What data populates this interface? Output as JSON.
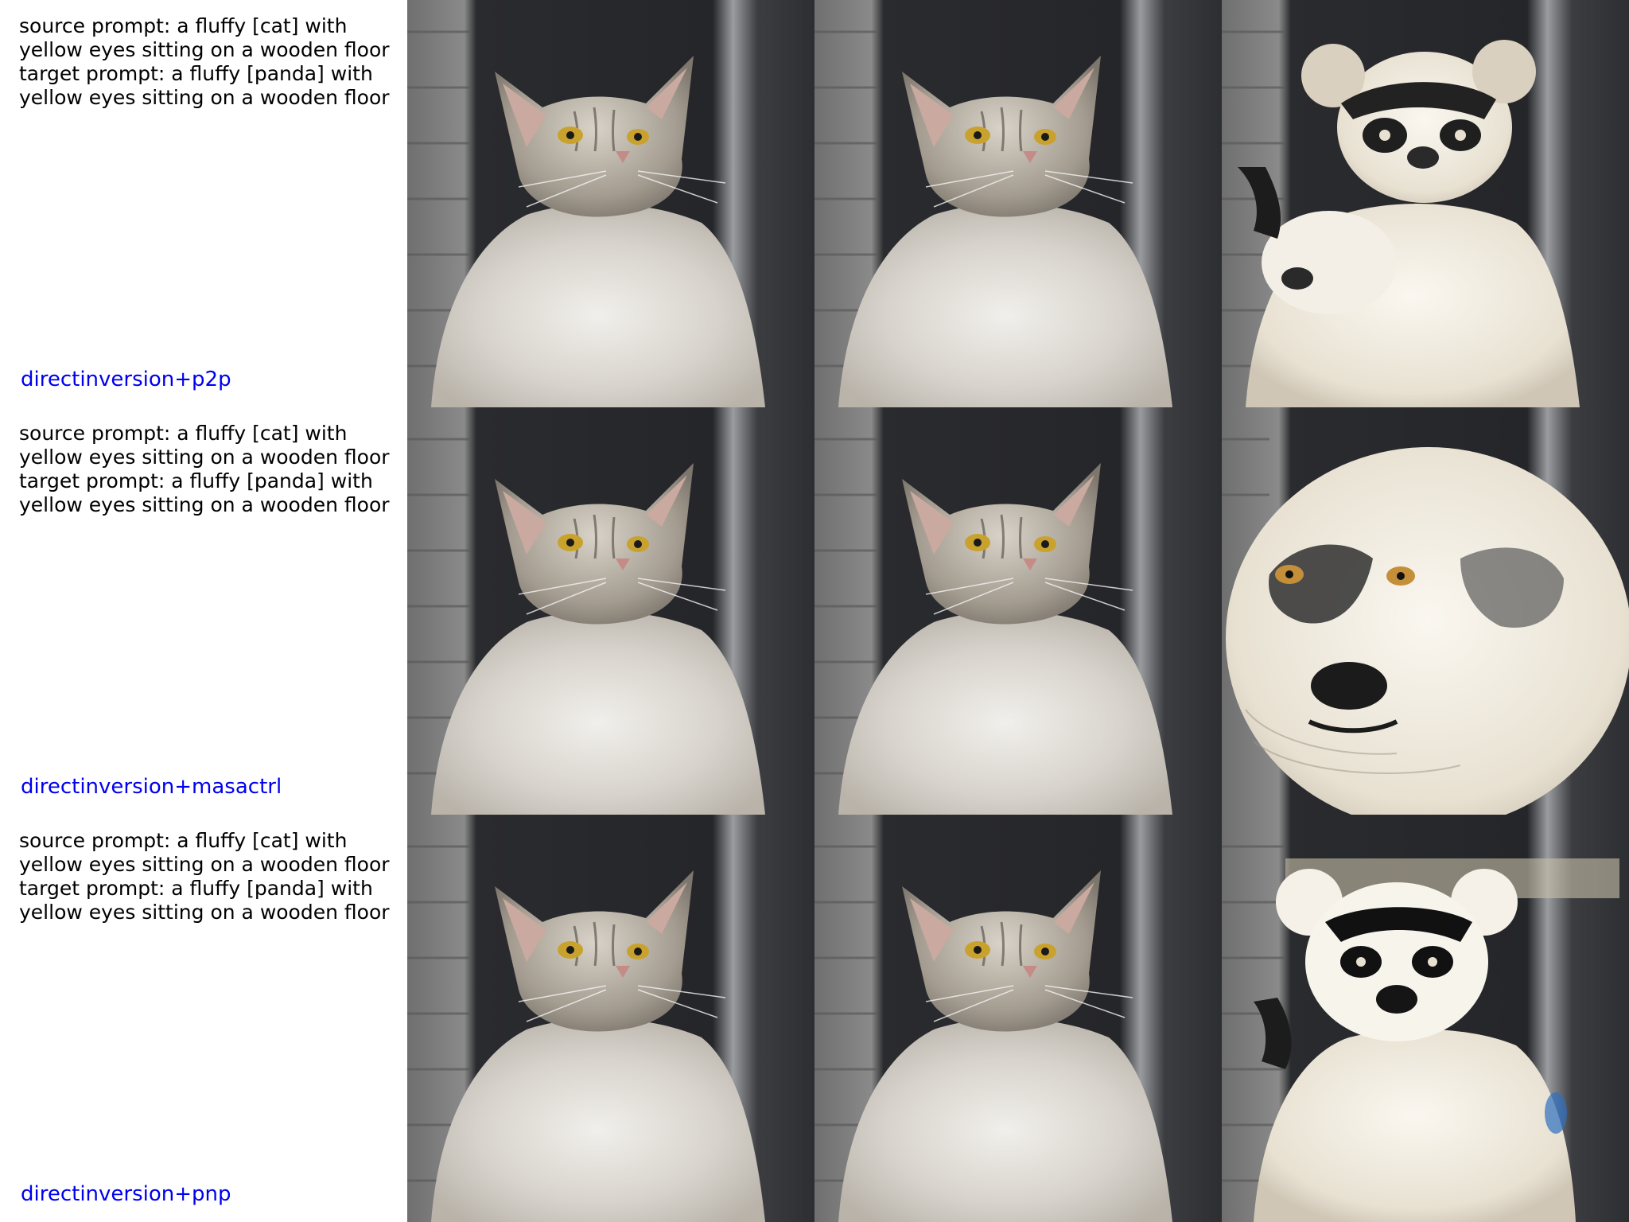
{
  "rows": [
    {
      "source_prompt": [
        "source prompt: a fluffy [cat] with",
        "yellow eyes sitting on a wooden floor"
      ],
      "target_prompt": [
        "target prompt: a fluffy [panda] with",
        "yellow eyes sitting on a wooden floor"
      ],
      "method": "directinversion+p2p",
      "method_color": "#0000ee",
      "images": [
        "cat-photo",
        "cat-photo",
        "panda-edit-double-head"
      ]
    },
    {
      "source_prompt": [
        "source prompt: a fluffy [cat] with",
        "yellow eyes sitting on a wooden floor"
      ],
      "target_prompt": [
        "target prompt: a fluffy [panda] with",
        "yellow eyes sitting on a wooden floor"
      ],
      "method": "directinversion+masactrl",
      "method_color": "#0000ee",
      "images": [
        "cat-photo",
        "cat-photo",
        "panda-edit-closeup"
      ]
    },
    {
      "source_prompt": [
        "source prompt: a fluffy [cat] with",
        "yellow eyes sitting on a wooden floor"
      ],
      "target_prompt": [
        "target prompt: a fluffy [panda] with",
        "yellow eyes sitting on a wooden floor"
      ],
      "method": "directinversion+pnp",
      "method_color": "#0000ee",
      "images": [
        "cat-photo",
        "cat-photo",
        "panda-edit"
      ]
    }
  ]
}
